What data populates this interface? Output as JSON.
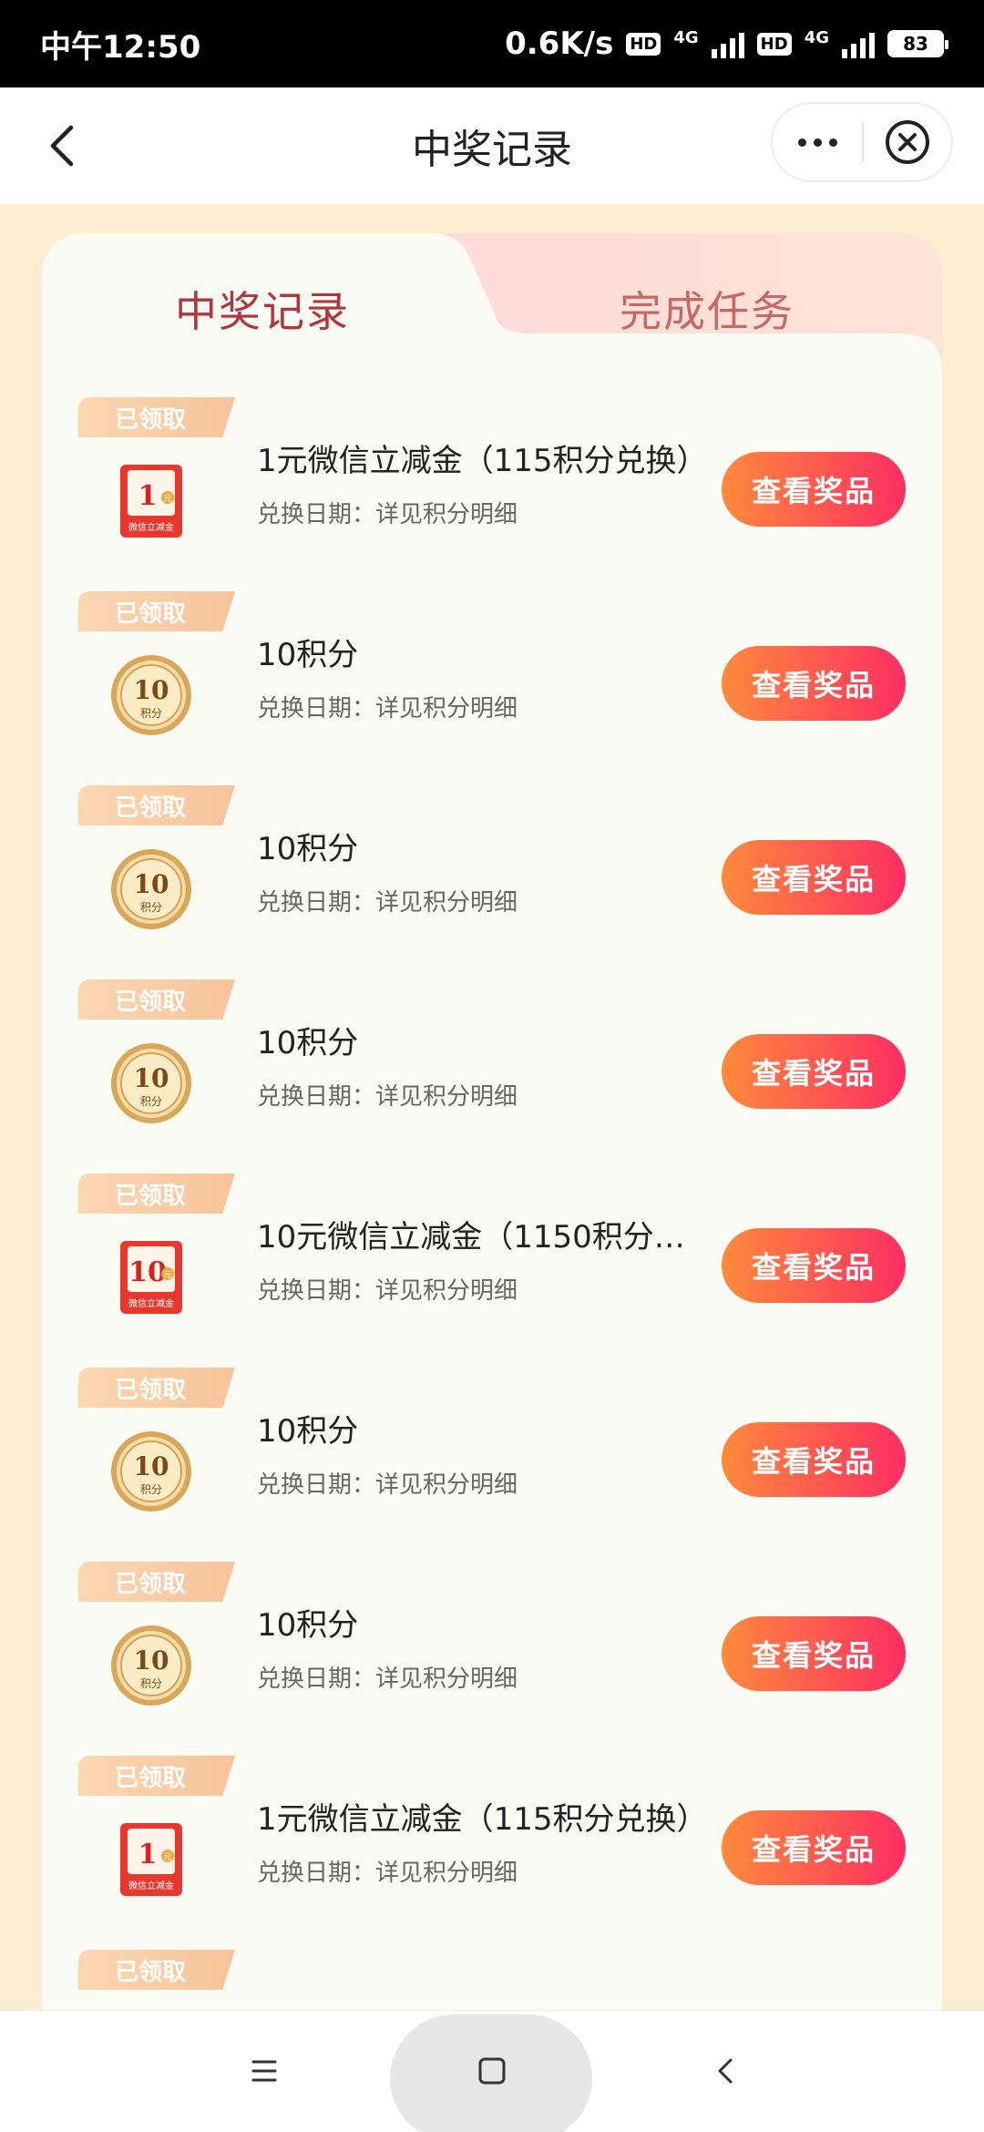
{
  "status_bar": {
    "time": "中午12:50",
    "speed": "0.6K/s",
    "hd": "HD",
    "net": "4G",
    "battery": "83"
  },
  "header": {
    "title": "中奖记录"
  },
  "tabs": [
    {
      "label": "中奖记录",
      "active": true
    },
    {
      "label": "完成任务",
      "active": false
    }
  ],
  "badge_label": "已领取",
  "button_label": "查看奖品",
  "items": [
    {
      "title": "1元微信立减金（115积分兑换）",
      "subtitle": "兑换日期：详见积分明细",
      "icon": "red-envelope-1-yuan-icon",
      "amount": "1"
    },
    {
      "title": "10积分",
      "subtitle": "兑换日期：详见积分明细",
      "icon": "gold-coin-10-points-icon",
      "amount": "10"
    },
    {
      "title": "10积分",
      "subtitle": "兑换日期：详见积分明细",
      "icon": "gold-coin-10-points-icon",
      "amount": "10"
    },
    {
      "title": "10积分",
      "subtitle": "兑换日期：详见积分明细",
      "icon": "gold-coin-10-points-icon",
      "amount": "10"
    },
    {
      "title": "10元微信立减金（1150积分兑...",
      "subtitle": "兑换日期：详见积分明细",
      "icon": "red-envelope-10-yuan-icon",
      "amount": "10"
    },
    {
      "title": "10积分",
      "subtitle": "兑换日期：详见积分明细",
      "icon": "gold-coin-10-points-icon",
      "amount": "10"
    },
    {
      "title": "10积分",
      "subtitle": "兑换日期：详见积分明细",
      "icon": "gold-coin-10-points-icon",
      "amount": "10"
    },
    {
      "title": "1元微信立减金（115积分兑换）",
      "subtitle": "兑换日期：详见积分明细",
      "icon": "red-envelope-1-yuan-icon",
      "amount": "1"
    }
  ],
  "icon_text": {
    "coin_caption": "积分",
    "envelope_caption": "微信立减金",
    "envelope_unit": "元"
  },
  "colors": {
    "page_bg": "#fdeed1",
    "active_tab": "#b2343c",
    "button_start": "#ff8a3c",
    "button_end": "#ff2e62"
  }
}
